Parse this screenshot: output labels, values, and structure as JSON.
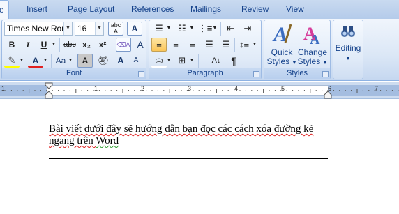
{
  "tabs": [
    {
      "label": "e"
    },
    {
      "label": "Insert"
    },
    {
      "label": "Page Layout"
    },
    {
      "label": "References"
    },
    {
      "label": "Mailings"
    },
    {
      "label": "Review"
    },
    {
      "label": "View"
    }
  ],
  "font_group": {
    "label": "Font",
    "font_name": "Times New Roma",
    "font_size": "16",
    "buttons": [
      "B",
      "I",
      "U",
      "abc",
      "x₂",
      "x²",
      "Aa",
      "A",
      "A"
    ]
  },
  "paragraph_group": {
    "label": "Paragraph",
    "pilcrow": "¶"
  },
  "styles_group": {
    "label": "Styles",
    "quick_styles_line1": "Quick",
    "quick_styles_line2": "Styles",
    "change_styles_line1": "Change",
    "change_styles_line2": "Styles"
  },
  "editing_group": {
    "label": "Editing"
  },
  "ruler": {
    "numbers": [
      "1",
      "1",
      "2",
      "3",
      "4",
      "5",
      "6",
      "7"
    ]
  },
  "document": {
    "line1_part1": "Bài viết dưới đây sẽ hướng dẫn bạn đọc các cách xóa đường kẻ",
    "line2_part1": "ngang trên ",
    "line2_part2": "Word"
  },
  "colors": {
    "accent": "#15428b",
    "ribbon": "#dbe7f6",
    "highlight_active": "#fbc659",
    "font_color_red": "#e02020"
  }
}
